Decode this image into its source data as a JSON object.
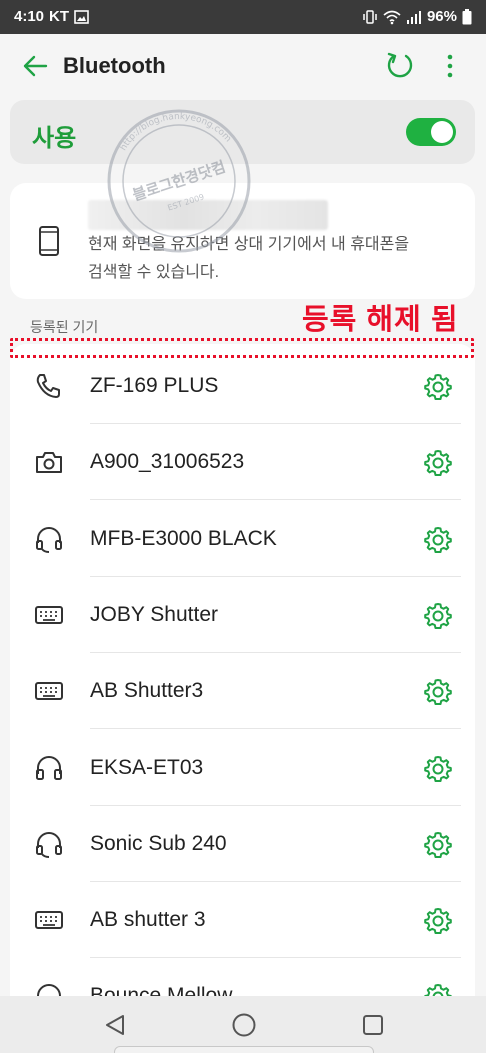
{
  "status_bar": {
    "time": "4:10",
    "carrier": "KT",
    "battery": "96%"
  },
  "header": {
    "title": "Bluetooth"
  },
  "toggle": {
    "label": "사용",
    "state": "on",
    "accent_color": "#1fb141"
  },
  "info_card": {
    "description": "현재 화면을 유지하면 상대 기기에서 내 휴대폰을 검색할 수 있습니다."
  },
  "section": {
    "registered_label": "등록된 기기"
  },
  "annotation": {
    "text": "등록 해제 됨",
    "color": "#e8102a"
  },
  "watermark": {
    "center_text": "블로그한경닷컴",
    "ring_text": "http://blog.hankyeong.com",
    "est_text": "EST 2009"
  },
  "devices": [
    {
      "name": "ZF-169 PLUS",
      "icon": "phone-handset-icon"
    },
    {
      "name": "A900_31006523",
      "icon": "camera-icon"
    },
    {
      "name": "MFB-E3000 BLACK",
      "icon": "headset-icon"
    },
    {
      "name": "JOBY Shutter",
      "icon": "keyboard-icon"
    },
    {
      "name": "AB Shutter3",
      "icon": "keyboard-icon"
    },
    {
      "name": "EKSA-ET03",
      "icon": "headphones-icon"
    },
    {
      "name": "Sonic Sub 240",
      "icon": "headset-icon"
    },
    {
      "name": "AB shutter 3",
      "icon": "keyboard-icon"
    },
    {
      "name": "Bounce Mellow",
      "icon": "headphones-icon"
    }
  ]
}
